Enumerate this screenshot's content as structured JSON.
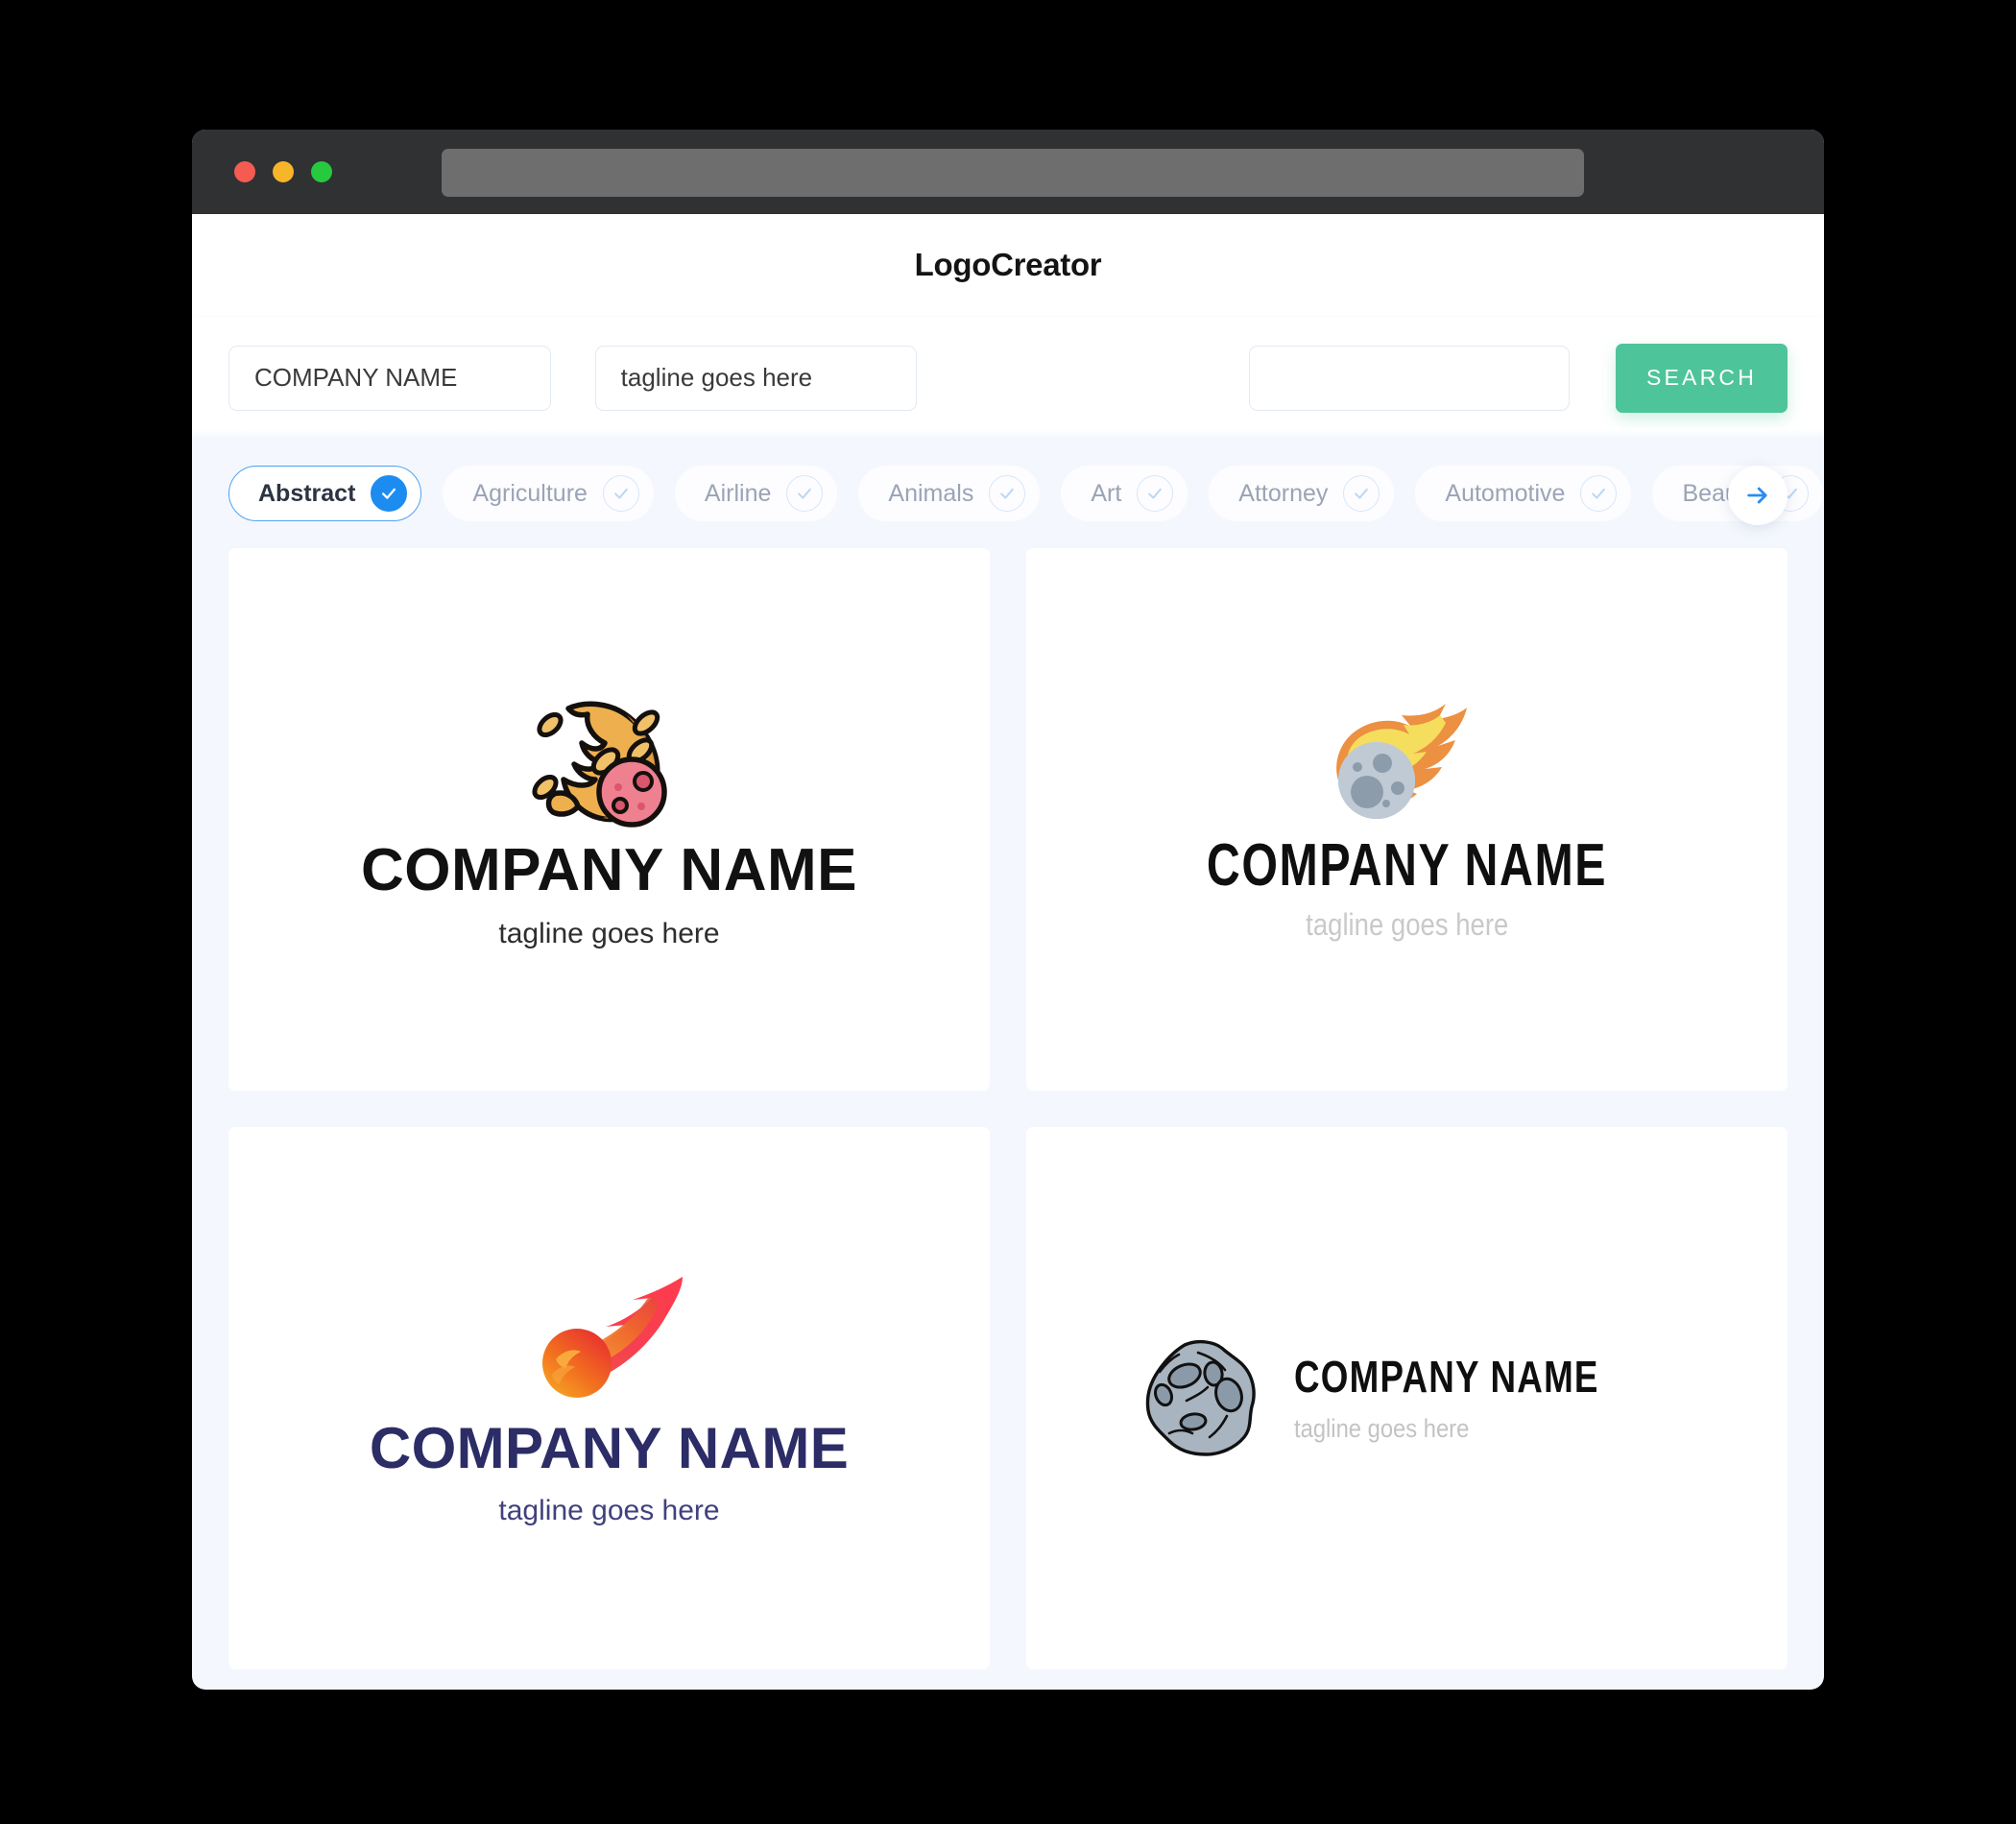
{
  "window": {
    "traffic_lights": [
      {
        "name": "close",
        "color": "#f55b50"
      },
      {
        "name": "minimize",
        "color": "#f7b529"
      },
      {
        "name": "maximize",
        "color": "#27c93f"
      }
    ],
    "url_bar_value": ""
  },
  "header": {
    "title": "LogoCreator"
  },
  "search": {
    "company_name_value": "COMPANY NAME",
    "company_name_placeholder": "COMPANY NAME",
    "tagline_value": "tagline goes here",
    "tagline_placeholder": "tagline goes here",
    "keyword_value": "",
    "keyword_placeholder": "",
    "search_button_label": "SEARCH",
    "search_button_color": "#4ec49a"
  },
  "categories": {
    "selected": "Abstract",
    "accent_color": "#1d8cf0",
    "next_icon": "arrow-right-icon",
    "items": [
      {
        "label": "Abstract",
        "selected": true
      },
      {
        "label": "Agriculture",
        "selected": false
      },
      {
        "label": "Airline",
        "selected": false
      },
      {
        "label": "Animals",
        "selected": false
      },
      {
        "label": "Art",
        "selected": false
      },
      {
        "label": "Attorney",
        "selected": false
      },
      {
        "label": "Automotive",
        "selected": false
      },
      {
        "label": "Beauty",
        "selected": false
      }
    ]
  },
  "results": {
    "cards": [
      {
        "icon": "comet-flame-icon",
        "name": "COMPANY NAME",
        "tagline": "tagline goes here",
        "name_color": "#111111",
        "tagline_color": "#2e2e2e"
      },
      {
        "icon": "meteor-asteroid-flat-icon",
        "name": "COMPANY NAME",
        "tagline": "tagline goes here",
        "name_color": "#0f0f0f",
        "tagline_color": "#c9c9c9"
      },
      {
        "icon": "comet-gradient-icon",
        "name": "COMPANY NAME",
        "tagline": "tagline goes here",
        "name_color": "#2c2c66",
        "tagline_color": "#41417e"
      },
      {
        "icon": "asteroid-rock-icon",
        "name": "COMPANY NAME",
        "tagline": "tagline goes here",
        "name_color": "#0f0f0f",
        "tagline_color": "#c3c3c3"
      }
    ]
  }
}
